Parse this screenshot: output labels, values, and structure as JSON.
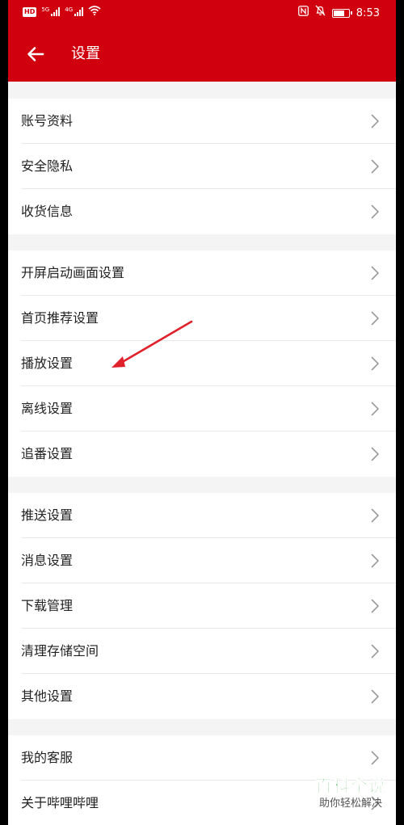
{
  "status_bar": {
    "hd_label": "HD",
    "net1_label": "5G",
    "net2_label": "4G",
    "time": "8:53",
    "battery_level": 0.75,
    "icons": [
      "hd-icon",
      "signal-icon",
      "signal-icon",
      "wifi-icon",
      "nfc-icon",
      "mute-icon",
      "battery-icon"
    ]
  },
  "header": {
    "title": "设置",
    "back_icon": "arrow-left-icon"
  },
  "sections": [
    {
      "items": [
        {
          "label": "账号资料"
        },
        {
          "label": "安全隐私"
        },
        {
          "label": "收货信息"
        }
      ]
    },
    {
      "items": [
        {
          "label": "开屏启动画面设置"
        },
        {
          "label": "首页推荐设置"
        },
        {
          "label": "播放设置"
        },
        {
          "label": "离线设置"
        },
        {
          "label": "追番设置"
        }
      ]
    },
    {
      "items": [
        {
          "label": "推送设置"
        },
        {
          "label": "消息设置"
        },
        {
          "label": "下载管理"
        },
        {
          "label": "清理存储空间"
        },
        {
          "label": "其他设置"
        }
      ]
    },
    {
      "items": [
        {
          "label": "我的客服"
        },
        {
          "label": "关于哔哩哔哩"
        }
      ]
    }
  ],
  "watermark": {
    "brand": "百科全说",
    "slogan": "助你轻松解决"
  },
  "colors": {
    "accent": "#d0000e",
    "annotation_arrow": "#e0202a",
    "watermark_green": "#2ea43a"
  }
}
